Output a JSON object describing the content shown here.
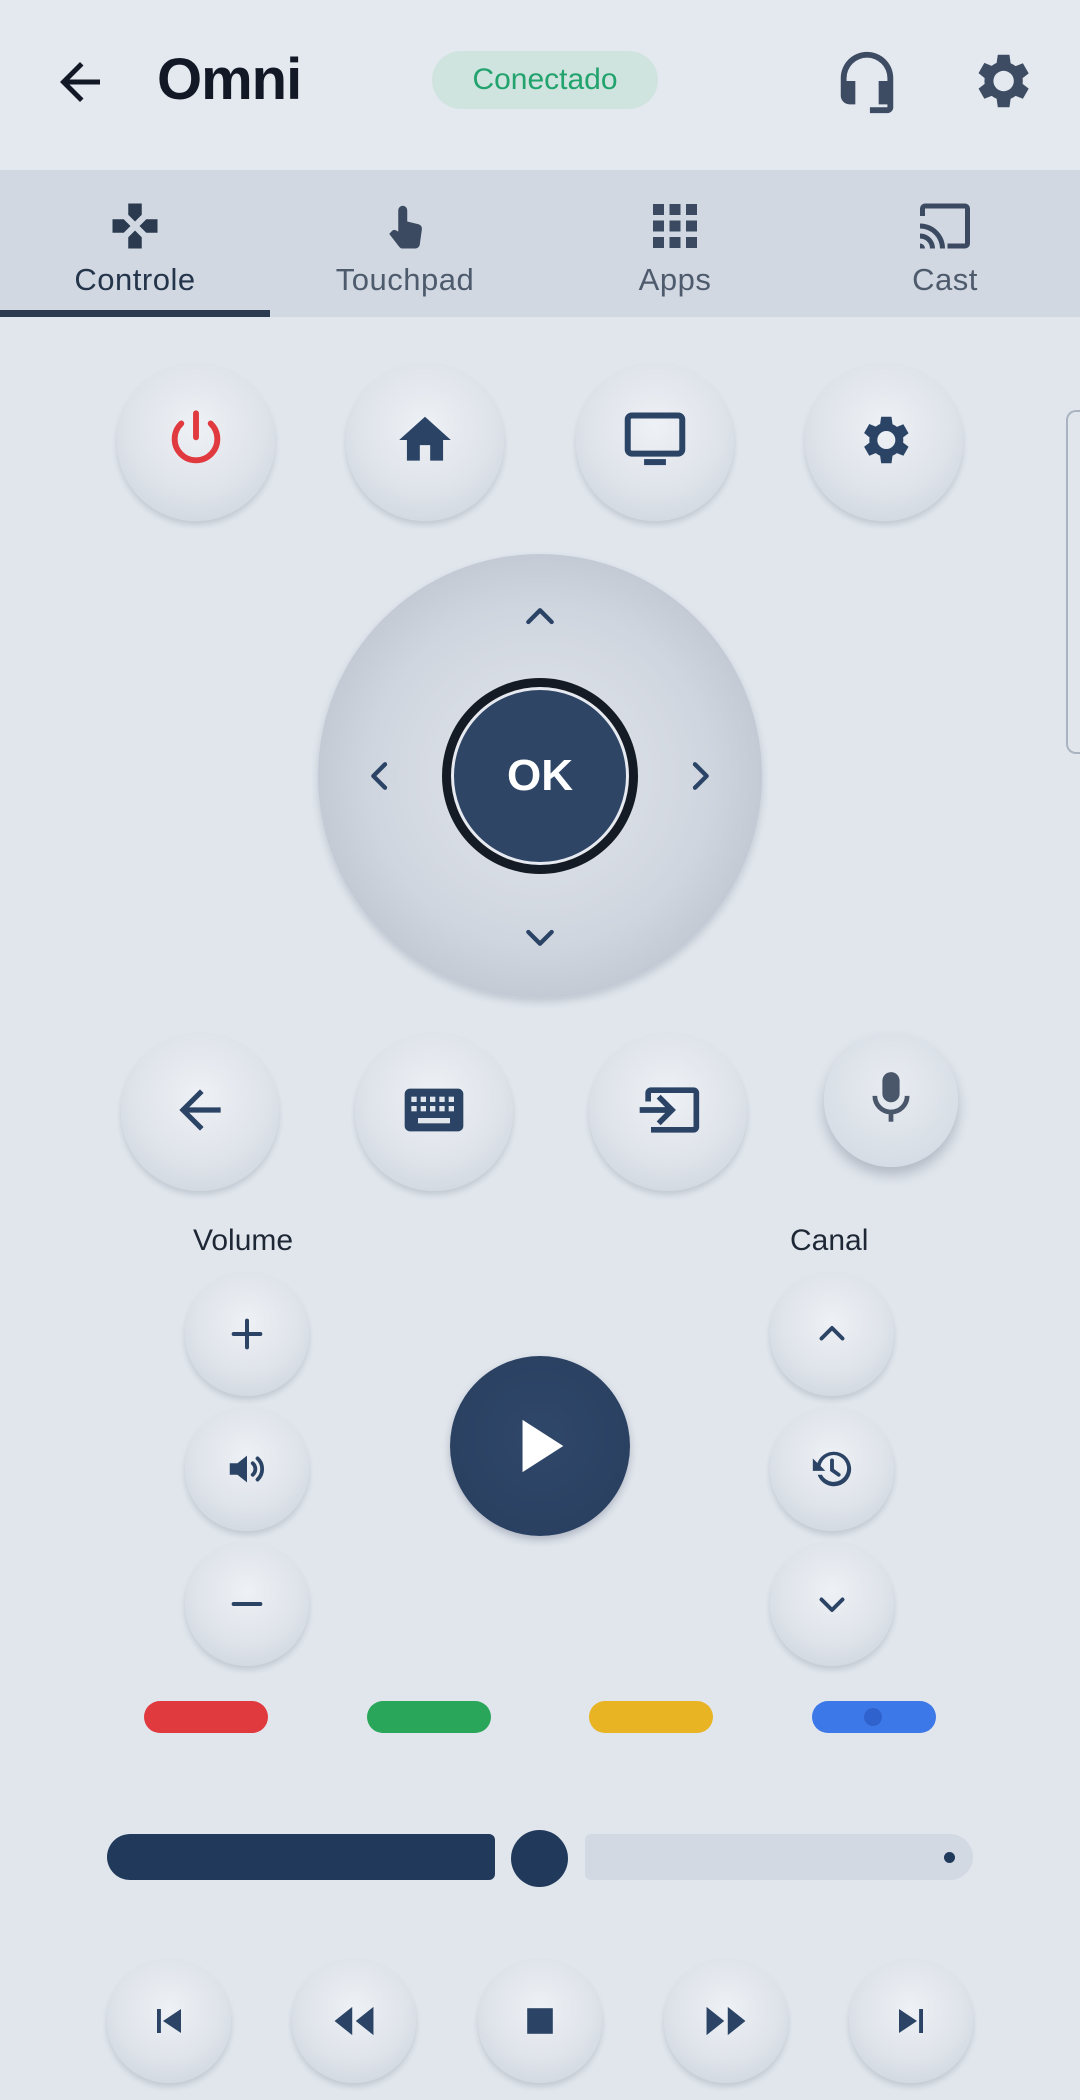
{
  "header": {
    "title": "Omni",
    "status": "Conectado",
    "status_color": "#22a36e",
    "icons": [
      "arrow-back-icon",
      "headset-icon",
      "gear-icon"
    ]
  },
  "tabs": [
    {
      "label": "Controle",
      "icon": "gamepad-icon",
      "active": true
    },
    {
      "label": "Touchpad",
      "icon": "touch-icon",
      "active": false
    },
    {
      "label": "Apps",
      "icon": "grid-icon",
      "active": false
    },
    {
      "label": "Cast",
      "icon": "cast-icon",
      "active": false
    }
  ],
  "top_buttons": [
    "power-icon",
    "home-icon",
    "tv-icon",
    "settings-icon"
  ],
  "dpad": {
    "ok_label": "OK"
  },
  "row_buttons": [
    "back-icon",
    "keyboard-icon",
    "input-icon",
    "mic-icon"
  ],
  "volume": {
    "label": "Volume"
  },
  "channel": {
    "label": "Canal"
  },
  "color_keys": [
    {
      "name": "red",
      "color": "#e0393e"
    },
    {
      "name": "green",
      "color": "#2aa65a"
    },
    {
      "name": "yellow",
      "color": "#e8b423"
    },
    {
      "name": "blue",
      "color": "#3d78e8"
    }
  ],
  "progress": {
    "fraction": 0.5
  },
  "media_buttons": [
    "skip-previous-icon",
    "rewind-icon",
    "stop-icon",
    "fast-forward-icon",
    "skip-next-icon"
  ],
  "colors": {
    "accent": "#213a5c",
    "power": "#e0393e",
    "icon": "#2b4466"
  }
}
